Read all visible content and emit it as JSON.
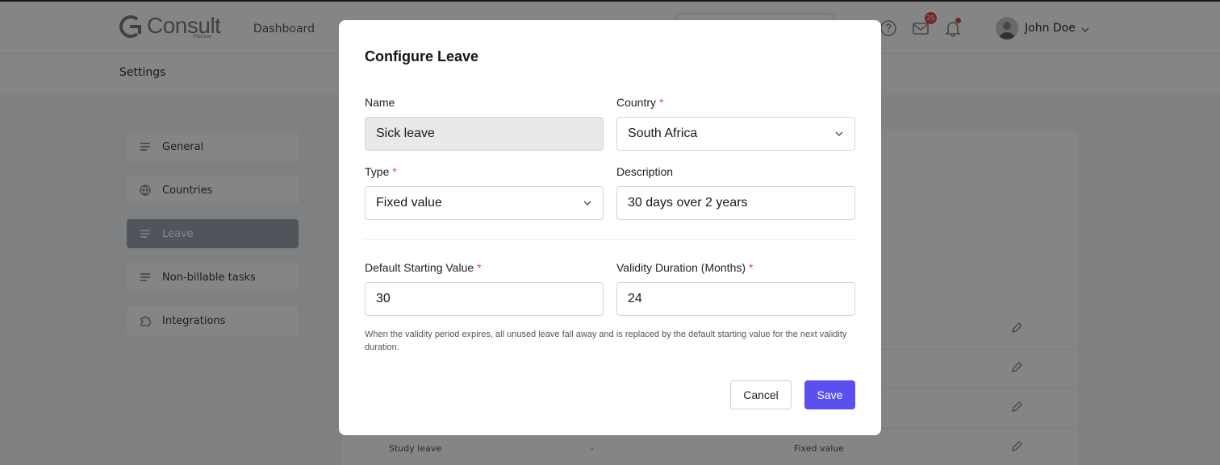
{
  "header": {
    "logo_text": "Consult",
    "logo_sub": "Planner",
    "nav_dashboard": "Dashboard",
    "mail_badge": "25",
    "user_name": "John Doe"
  },
  "page": {
    "title": "Settings"
  },
  "sidebar": {
    "items": [
      {
        "label": "General",
        "icon": "lines-icon"
      },
      {
        "label": "Countries",
        "icon": "globe-icon"
      },
      {
        "label": "Leave",
        "icon": "lines-icon",
        "active": true
      },
      {
        "label": "Non-billable tasks",
        "icon": "lines-icon"
      },
      {
        "label": "Integrations",
        "icon": "puzzle-icon"
      }
    ]
  },
  "table": {
    "rows": [
      {
        "name": "",
        "description": "",
        "type": ""
      },
      {
        "name": "",
        "description": "",
        "type": ""
      },
      {
        "name": "",
        "description": "",
        "type": ""
      },
      {
        "name": "Study leave",
        "description": "-",
        "type": "Fixed value"
      }
    ]
  },
  "modal": {
    "title": "Configure Leave",
    "name_label": "Name",
    "name_value": "Sick leave",
    "country_label": "Country",
    "country_value": "South Africa",
    "type_label": "Type",
    "type_value": "Fixed value",
    "description_label": "Description",
    "description_value": "30 days over 2 years",
    "default_start_label": "Default Starting Value",
    "default_start_value": "30",
    "validity_label": "Validity Duration (Months)",
    "validity_value": "24",
    "required_mark": "*",
    "hint": "When the validity period expires, all unused leave fall away and is replaced by the default starting value for the next validity duration.",
    "cancel_label": "Cancel",
    "save_label": "Save"
  },
  "colors": {
    "primary": "#5b4ff0",
    "required": "#e34b4b",
    "sidebar_active": "#9aa1ae"
  }
}
